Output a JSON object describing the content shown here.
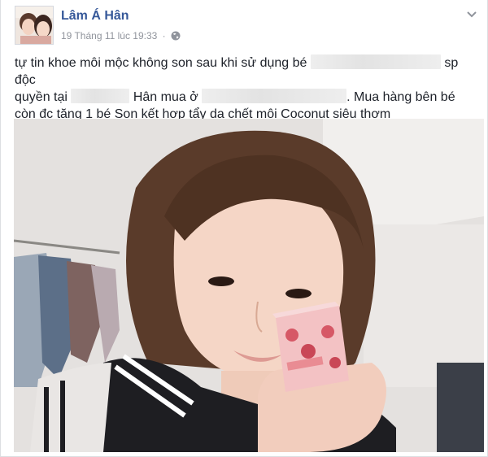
{
  "post": {
    "author_name": "Lâm Á Hân",
    "timestamp": "19 Tháng 11 lúc 19:33",
    "separator": "·",
    "privacy_icon": "globe-icon",
    "menu_icon": "chevron-down-icon",
    "text": {
      "line1_a": "tự tin khoe môi mộc không son sau khi sử dụng bé",
      "line1_b": "sp độc",
      "line2_a": "quyền tại",
      "line2_b": "Hân mua ở",
      "line2_c": ". Mua hàng bên bé",
      "line3": "còn đc tặng 1 bé Son kết hợp tẩy da chết môi Coconut siêu thơm"
    },
    "photo_icon": "photo-of-woman-holding-product-box"
  },
  "colors": {
    "link": "#365899",
    "meta": "#90949c",
    "text": "#1d2129",
    "border": "#dddfe2"
  }
}
